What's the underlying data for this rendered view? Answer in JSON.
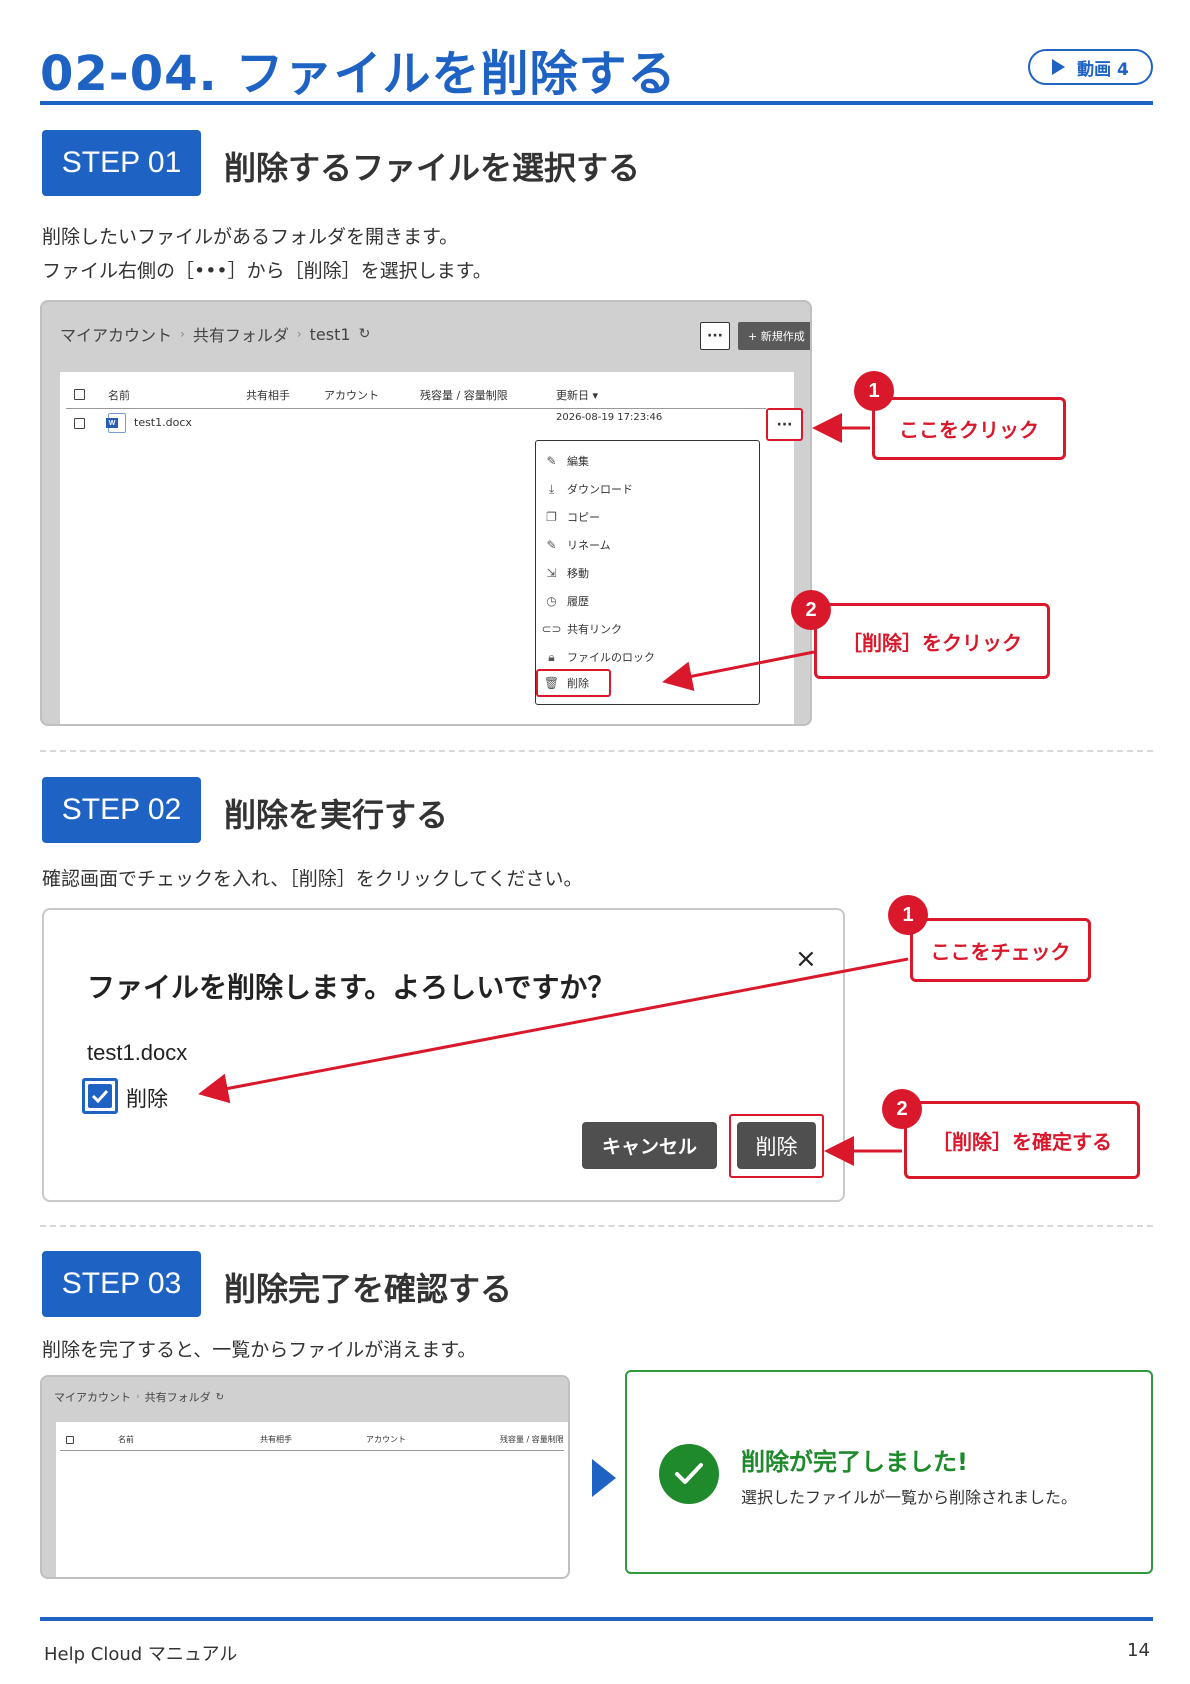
{
  "header": {
    "title": "02-04. ファイルを削除する",
    "video_label": "動画 4"
  },
  "step1": {
    "badge": "STEP 01",
    "title": "削除するファイルを選択する",
    "text_line1": "削除したいファイルがあるフォルダを開きます。",
    "text_line2": "ファイル右側の［•••］から［削除］を選択します。",
    "screen": {
      "breadcrumb": [
        "マイアカウント",
        "共有フォルダ",
        "test1"
      ],
      "more_button": "···",
      "new_button": "+ 新規作成",
      "columns": [
        "名前",
        "共有相手",
        "アカウント",
        "残容量 / 容量制限",
        "更新日 ▾"
      ],
      "file_name": "test1.docx",
      "file_date": "2026-08-19 17:23:46",
      "row_more": "···",
      "menu": [
        "編集",
        "ダウンロード",
        "コピー",
        "リネーム",
        "移動",
        "履歴",
        "共有リンク",
        "ファイルのロック",
        "削除"
      ]
    },
    "callout1": {
      "num": "1",
      "text": "ここをクリック"
    },
    "callout2": {
      "num": "2",
      "text": "［削除］をクリック"
    }
  },
  "step2": {
    "badge": "STEP 02",
    "title": "削除を実行する",
    "text": "確認画面でチェックを入れ、［削除］をクリックしてください。",
    "dialog": {
      "title": "ファイルを削除します。よろしいですか？",
      "file": "test1.docx",
      "checkbox_label": "削除",
      "close": "×",
      "cancel": "キャンセル",
      "delete": "削除"
    },
    "callout1": {
      "num": "1",
      "text": "ここをチェック"
    },
    "callout2": {
      "num": "2",
      "text": "［削除］を確定する"
    }
  },
  "step3": {
    "badge": "STEP 03",
    "title": "削除完了を確認する",
    "text": "削除を完了すると、一覧からファイルが消えます。",
    "screen": {
      "breadcrumb": [
        "マイアカウント",
        "共有フォルダ"
      ],
      "columns": [
        "名前",
        "共有相手",
        "アカウント",
        "残容量 / 容量制限"
      ]
    },
    "success": {
      "title": "削除が完了しました!",
      "subtitle": "選択したファイルが一覧から削除されました。"
    }
  },
  "footer": {
    "left": "Help Cloud マニュアル",
    "page": "14"
  },
  "colors": {
    "accent": "#1e63c3",
    "alert": "#d9182b",
    "success": "#1f8a2c"
  }
}
